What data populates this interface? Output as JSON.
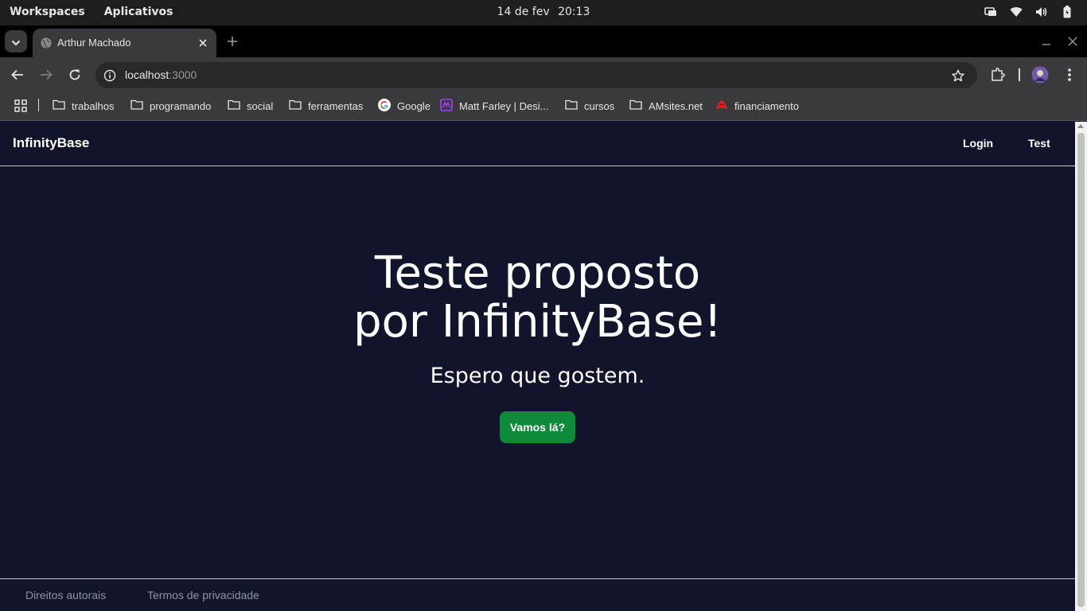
{
  "os": {
    "workspaces": "Workspaces",
    "apps": "Aplicativos",
    "date": "14 de fev",
    "time": "20:13"
  },
  "browser": {
    "tab_title": "Arthur Machado",
    "url_host": "localhost",
    "url_port": ":3000"
  },
  "bookmarks": [
    {
      "label": "trabalhos",
      "icon": "folder-icon"
    },
    {
      "label": "programando",
      "icon": "folder-icon"
    },
    {
      "label": "social",
      "icon": "folder-icon"
    },
    {
      "label": "ferramentas",
      "icon": "folder-icon"
    },
    {
      "label": "Google",
      "icon": "google-icon"
    },
    {
      "label": "Matt Farley | Desi...",
      "icon": "site-icon"
    },
    {
      "label": "cursos",
      "icon": "folder-icon"
    },
    {
      "label": "AMsites.net",
      "icon": "folder-icon"
    },
    {
      "label": "financiamento",
      "icon": "bank-icon"
    }
  ],
  "site": {
    "brand": "InfinityBase",
    "nav": {
      "login": "Login",
      "test": "Test"
    },
    "hero_line1": "Teste proposto",
    "hero_line2": "por InfinityBase!",
    "subtitle": "Espero que gostem.",
    "cta": "Vamos lá?",
    "footer": {
      "copyright": "Direitos autorais",
      "privacy": "Termos de privacidade"
    }
  },
  "colors": {
    "page_bg": "#11142a",
    "cta_bg": "#0e8a3a",
    "browser_chrome": "#3a3a3c"
  }
}
